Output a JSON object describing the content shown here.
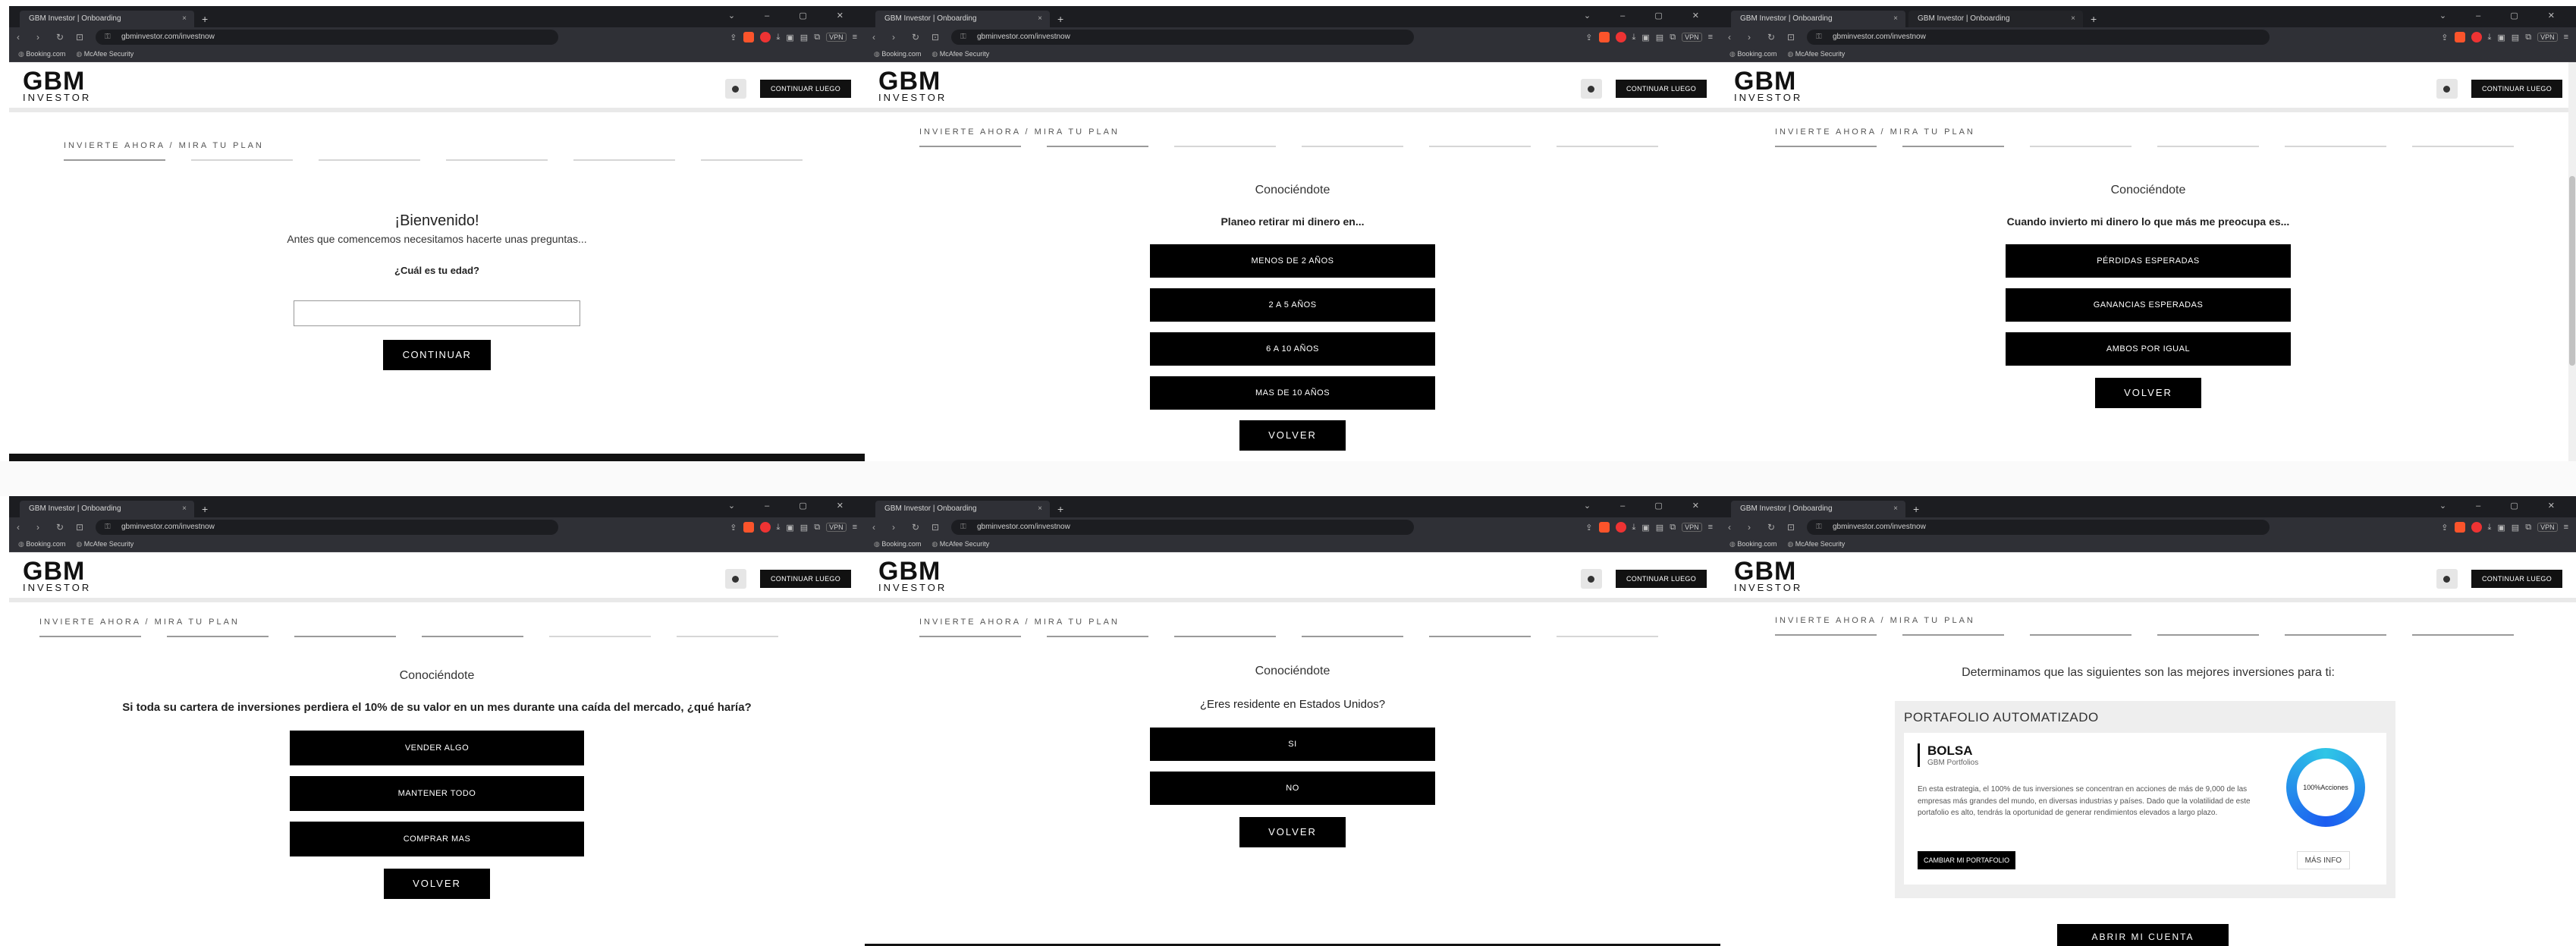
{
  "browser": {
    "tab_title": "GBM Investor | Onboarding",
    "tab_close": "×",
    "new_tab": "+",
    "url": "gbminvestor.com/investnow",
    "bookmarks": [
      "Booking.com",
      "McAfee Security"
    ],
    "vpn_label": "VPN",
    "window_controls": "⌄ – ▢ ✕"
  },
  "site": {
    "logo_main": "GBM",
    "logo_sub": "INVESTOR",
    "continue_later": "CONTINUAR LUEGO",
    "breadcrumb": "INVIERTE AHORA / MIRA TU PLAN"
  },
  "step_age": {
    "welcome": "¡Bienvenido!",
    "intro": "Antes que comencemos necesitamos hacerte unas preguntas...",
    "question": "¿Cuál es tu edad?",
    "input_value": "",
    "continue": "CONTINUAR"
  },
  "section_title": "Conociéndote",
  "back_label": "VOLVER",
  "step_withdraw": {
    "question": "Planeo retirar mi dinero en...",
    "options": [
      "MENOS DE 2 AÑOS",
      "2 A 5 AÑOS",
      "6 A 10 AÑOS",
      "MAS DE 10 AÑOS"
    ]
  },
  "step_concern": {
    "question": "Cuando invierto mi dinero lo que más me preocupa es...",
    "options": [
      "PÉRDIDAS ESPERADAS",
      "GANANCIAS ESPERADAS",
      "AMBOS POR IGUAL"
    ]
  },
  "step_drop": {
    "question": "Si toda su cartera de inversiones perdiera el 10% de su valor en un mes durante una caída del mercado, ¿qué haría?",
    "options": [
      "VENDER ALGO",
      "MANTENER TODO",
      "COMPRAR MAS"
    ]
  },
  "step_resident": {
    "question": "¿Eres residente en Estados Unidos?",
    "options": [
      "SI",
      "NO"
    ]
  },
  "step_result": {
    "headline": "Determinamos que las siguientes son las mejores inversiones para ti:",
    "portfolio_section": "PORTAFOLIO AUTOMATIZADO",
    "portfolio_name": "BOLSA",
    "portfolio_provider": "GBM Portfolios",
    "description": "En esta estrategia, el 100% de tus inversiones se concentran en acciones de más de 9,000 de las empresas más grandes del mundo, en diversas industrias y países. Dado que la volatilidad de este portafolio es alto, tendrás la oportunidad de generar rendimientos elevados a largo plazo.",
    "donut_label": "100%Acciones",
    "donut_percent": 100,
    "change_portfolio": "CAMBIAR MI PORTAFOLIO",
    "more_info": "MÁS INFO",
    "open_account": "ABRIR MI CUENTA"
  },
  "colors": {
    "primary": "#000000",
    "donut_start": "#2fc6e6",
    "donut_end": "#1b5cf0",
    "browser_dark": "#1c1d21"
  }
}
